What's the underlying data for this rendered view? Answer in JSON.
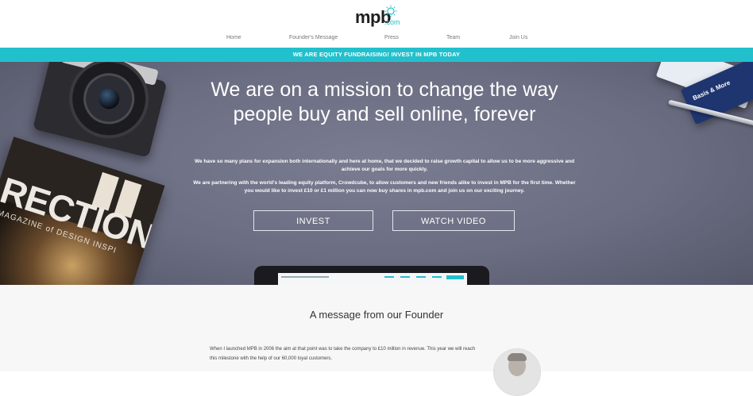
{
  "header": {
    "logo_main": "mpb",
    "logo_sub": ".com",
    "nav": [
      {
        "label": "Home"
      },
      {
        "label": "Founder's Message"
      },
      {
        "label": "Press"
      },
      {
        "label": "Team"
      },
      {
        "label": "Join Us"
      }
    ]
  },
  "banner": {
    "text": "WE ARE EQUITY FUNDRAISING! INVEST IN MPB TODAY"
  },
  "hero": {
    "title": "We are on a mission to change the way people buy and sell online, forever",
    "paragraph1": "We have so many plans for expansion both internationally and here at home, that we decided to raise growth capital to allow us to be more aggressive and achieve our goals for more quickly.",
    "paragraph2": "We are partnering with the world's leading equity platform, Crowdcube, to allow customers and new friends alike to invest in MPB for the first time. Whether you would like to invest £10 or £1 million you can now buy shares in mpb.com and join us on our exciting journey.",
    "invest_label": "INVEST",
    "video_label": "WATCH VIDEO",
    "magazine_title": "RECTIONS",
    "magazine_sub": "MAGAZINE of DESIGN INSPI",
    "card_text": "Basis & More"
  },
  "founder": {
    "title": "A message from our Founder",
    "text": "When I launched MPB in 2006 the aim at that point was to take the company to £10 million in revenue. This year we will reach this milestone with the help of our 60,000 loyal customers."
  },
  "colors": {
    "accent": "#22c0cc",
    "hero_bg": "#6c6e84"
  }
}
